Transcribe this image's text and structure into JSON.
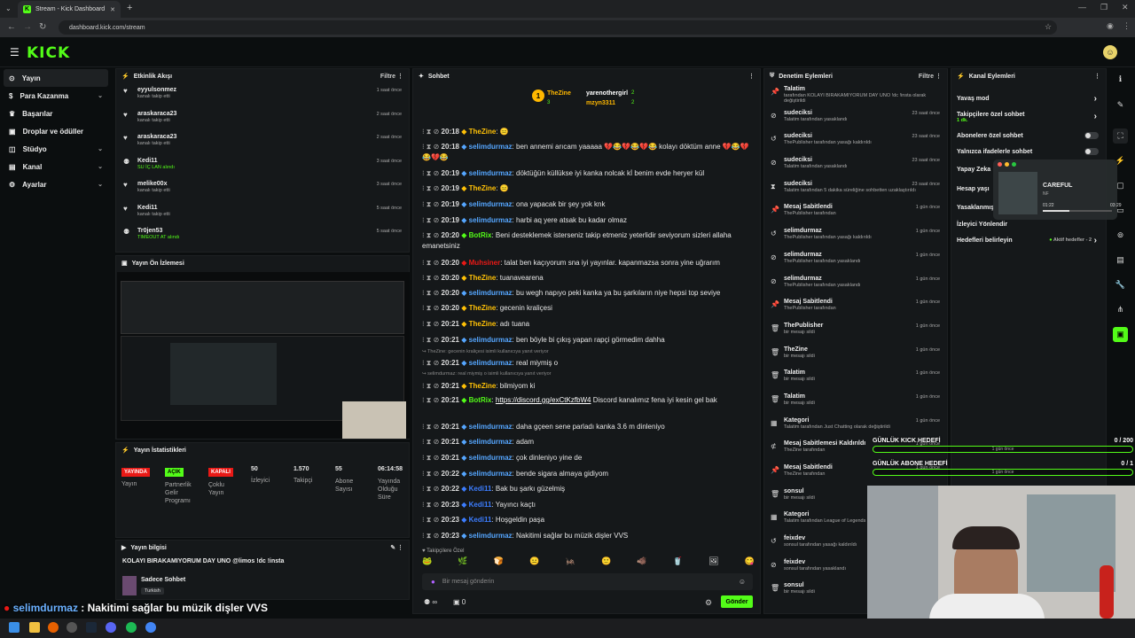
{
  "browser": {
    "tab_title": "Stream - Kick Dashboard",
    "url": "dashboard.kick.com/stream"
  },
  "app": {
    "logo": "KICK"
  },
  "sidebar": {
    "items": [
      {
        "label": "Yayın",
        "icon": "broadcast-icon",
        "active": true
      },
      {
        "label": "Para Kazanma",
        "icon": "dollar-icon",
        "chevron": true
      },
      {
        "label": "Başarılar",
        "icon": "trophy-icon"
      },
      {
        "label": "Droplar ve ödüller",
        "icon": "gift-icon"
      },
      {
        "label": "Stüdyo",
        "icon": "studio-icon",
        "chevron": true
      },
      {
        "label": "Kanal",
        "icon": "channel-icon",
        "chevron": true
      },
      {
        "label": "Ayarlar",
        "icon": "gear-icon",
        "chevron": true
      }
    ]
  },
  "activity": {
    "title": "Etkinlik Akışı",
    "filter": "Filtre",
    "items": [
      {
        "name": "eyyulsonmez",
        "sub": "kanalı takip etti",
        "time": "1 saat önce",
        "icon": "heart"
      },
      {
        "name": "araskaraca23",
        "sub": "kanalı takip etti",
        "time": "2 saat önce",
        "icon": "heart"
      },
      {
        "name": "araskaraca23",
        "sub": "kanalı takip etti",
        "time": "2 saat önce",
        "icon": "heart"
      },
      {
        "name": "Kedi11",
        "sub": "SU İÇ LAN alındı",
        "time": "3 saat önce",
        "icon": "reward"
      },
      {
        "name": "melike00x",
        "sub": "kanalı takip etti",
        "time": "3 saat önce",
        "icon": "heart"
      },
      {
        "name": "Kedi11",
        "sub": "kanalı takip etti",
        "time": "5 saat önce",
        "icon": "heart"
      },
      {
        "name": "Tr0jen53",
        "sub": "TIMEOUT AT alındı",
        "time": "5 saat önce",
        "icon": "reward"
      }
    ]
  },
  "preview": {
    "title": "Yayın Ön İzlemesi"
  },
  "stats": {
    "title": "Yayın İstatistikleri",
    "items": [
      {
        "value": "YAYINDA",
        "label": "Yayın",
        "style": "red"
      },
      {
        "value": "AÇIK",
        "label": "Partnerlik Gelir Programı",
        "style": "green"
      },
      {
        "value": "KAPALI",
        "label": "Çoklu Yayın",
        "style": "red"
      },
      {
        "value": "50",
        "label": "İzleyici"
      },
      {
        "value": "1.570",
        "label": "Takipçi"
      },
      {
        "value": "55",
        "label": "Abone Sayısı"
      },
      {
        "value": "06:14:58",
        "label": "Yayında Olduğu Süre"
      }
    ]
  },
  "streaminfo": {
    "title": "Yayın bilgisi",
    "stream_title": "KOLAYI BIRAKAMIYORUM DAY UNO @limos !dc !insta",
    "category": "Sadece Sohbet",
    "language": "Turkish"
  },
  "chat": {
    "title": "Sohbet",
    "gifters": [
      {
        "name": "TheZine",
        "count": "3",
        "color": "#ffb800"
      },
      {
        "name": "yarenothergirl",
        "count": "2",
        "color": "#ffffff"
      },
      {
        "name": "mzyn3311",
        "count": "2",
        "color": "#ffb800"
      }
    ],
    "messages": [
      {
        "time": "20:18",
        "user": "TheZine",
        "color": "#ffc107",
        "text": "😐"
      },
      {
        "time": "20:18",
        "user": "selimdurmaz",
        "color": "#55a6ff",
        "text": "ben annemi arıcam yaaaaa 💔😂💔😂💔😂 kolayı döktüm anne 💔😂💔😂💔😂"
      },
      {
        "time": "20:19",
        "user": "selimdurmaz",
        "color": "#55a6ff",
        "text": "döktüğün küllükse iyi kanka nolcak kİ benim evde heryer kül"
      },
      {
        "time": "20:19",
        "user": "TheZine",
        "color": "#ffc107",
        "text": "😐"
      },
      {
        "time": "20:19",
        "user": "selimdurmaz",
        "color": "#55a6ff",
        "text": "ona yapacak bir şey yok knk"
      },
      {
        "time": "20:19",
        "user": "selimdurmaz",
        "color": "#55a6ff",
        "text": "harbi aq yere atsak bu kadar olmaz"
      },
      {
        "time": "20:20",
        "user": "BotRix",
        "color": "#53fc18",
        "text": "Beni desteklemek isterseniz takip etmeniz yeterlidir seviyorum sizleri allaha emanetsiniz"
      },
      {
        "time": "20:20",
        "user": "Muhsiner",
        "color": "#e91916",
        "text": "talat ben kaçıyorum sna iyi yayınlar. kapanmazsa sonra yine uğrarım"
      },
      {
        "time": "20:20",
        "user": "TheZine",
        "color": "#ffc107",
        "text": "tuanavearena"
      },
      {
        "time": "20:20",
        "user": "selimdurmaz",
        "color": "#55a6ff",
        "text": "bu wegh napıyo peki kanka ya bu şarkıların niye hepsi top seviye"
      },
      {
        "time": "20:20",
        "user": "TheZine",
        "color": "#ffc107",
        "text": "gecenin kraliçesi"
      },
      {
        "time": "20:21",
        "user": "TheZine",
        "color": "#ffc107",
        "text": "adı tuana"
      },
      {
        "time": "20:21",
        "user": "selimdurmaz",
        "color": "#55a6ff",
        "text": "ben böyle bi çıkış yapan rapçi görmedim dahha"
      },
      {
        "reply": "TheZine: gecenin kraliçesi isimli kullanıcıya yanıt veriyor"
      },
      {
        "time": "20:21",
        "user": "selimdurmaz",
        "color": "#55a6ff",
        "text": "real miymiş o"
      },
      {
        "reply": "selimdurmaz: real miymiş o isimli kullanıcıya yanıt veriyor"
      },
      {
        "time": "20:21",
        "user": "TheZine",
        "color": "#ffc107",
        "text": "bilmiyom ki"
      },
      {
        "time": "20:21",
        "user": "BotRix",
        "color": "#53fc18",
        "link": "https://discord.gg/exCtKzfbW4",
        "text": "Discord kanalımız fena iyi kesin gel bak"
      },
      {
        "time": "20:21",
        "user": "selimdurmaz",
        "color": "#55a6ff",
        "text": "daha gçeen sene parladı kanka 3.6 m dinleniyo"
      },
      {
        "time": "20:21",
        "user": "selimdurmaz",
        "color": "#55a6ff",
        "text": "adam"
      },
      {
        "time": "20:21",
        "user": "selimdurmaz",
        "color": "#55a6ff",
        "text": "çok dinleniyo yine de"
      },
      {
        "time": "20:22",
        "user": "selimdurmaz",
        "color": "#55a6ff",
        "text": "bende sigara almaya gidiyom"
      },
      {
        "time": "20:22",
        "user": "Kedi11",
        "color": "#3c7dff",
        "text": "Bak bu şarkı güzelmiş"
      },
      {
        "time": "20:23",
        "user": "Kedi11",
        "color": "#3c7dff",
        "text": "Yayıncı kaçtı"
      },
      {
        "time": "20:23",
        "user": "Kedi11",
        "color": "#3c7dff",
        "text": "Hoşgeldin paşa"
      },
      {
        "time": "20:23",
        "user": "selimdurmaz",
        "color": "#55a6ff",
        "text": "Nakitimi sağlar bu müzik dişler VVS"
      }
    ],
    "followers_label": "Takipçilere Özel",
    "input_placeholder": "Bir mesaj gönderin",
    "points": "0",
    "send": "Gönder"
  },
  "modlog": {
    "title": "Denetim Eylemleri",
    "filter": "Filtre",
    "items": [
      {
        "name": "Talatim",
        "sub": "tarafından KOLAYI BIRAKAMIYORUM DAY UNO !dc !insta olarak değiştirildi",
        "time": "",
        "icon": "pin"
      },
      {
        "name": "sudeciksi",
        "sub": "Talatim tarafından yasaklandı",
        "time": "23 saat önce",
        "icon": "ban"
      },
      {
        "name": "sudeciksi",
        "sub": "ThePublisher tarafından yasağı kaldırıldı",
        "time": "23 saat önce",
        "icon": "undo"
      },
      {
        "name": "sudeciksi",
        "sub": "Talatim tarafından yasaklandı",
        "time": "23 saat önce",
        "icon": "ban"
      },
      {
        "name": "sudeciksi",
        "sub": "Talatim tarafından 5 dakika süreliğine sohbetten uzaklaştırıldı",
        "time": "23 saat önce",
        "icon": "timer"
      },
      {
        "name": "Mesaj Sabitlendi",
        "sub": "ThePublisher tarafından",
        "time": "1 gün önce",
        "icon": "pin"
      },
      {
        "name": "selimdurmaz",
        "sub": "ThePublisher tarafından yasağı kaldırıldı",
        "time": "1 gün önce",
        "icon": "undo"
      },
      {
        "name": "selimdurmaz",
        "sub": "ThePublisher tarafından yasaklandı",
        "time": "1 gün önce",
        "icon": "ban"
      },
      {
        "name": "selimdurmaz",
        "sub": "ThePublisher tarafından yasaklandı",
        "time": "1 gün önce",
        "icon": "ban"
      },
      {
        "name": "Mesaj Sabitlendi",
        "sub": "ThePublisher tarafından",
        "time": "1 gün önce",
        "icon": "pin"
      },
      {
        "name": "ThePublisher",
        "sub": "bir mesajı sildi",
        "time": "1 gün önce",
        "icon": "trash"
      },
      {
        "name": "TheZine",
        "sub": "bir mesajı sildi",
        "time": "1 gün önce",
        "icon": "trash"
      },
      {
        "name": "Talatim",
        "sub": "bir mesajı sildi",
        "time": "1 gün önce",
        "icon": "trash"
      },
      {
        "name": "Talatim",
        "sub": "bir mesajı sildi",
        "time": "1 gün önce",
        "icon": "trash"
      },
      {
        "name": "Kategori",
        "sub": "Talatim tarafından Just Chatting olarak değiştirildi",
        "time": "1 gün önce",
        "icon": "category"
      },
      {
        "name": "Mesaj Sabitlemesi Kaldırıldı",
        "sub": "TheZine tarafından",
        "time": "1 gün önce",
        "icon": "unpin"
      },
      {
        "name": "Mesaj Sabitlendi",
        "sub": "TheZine tarafından",
        "time": "1 gün önce",
        "icon": "pin"
      },
      {
        "name": "sonsul",
        "sub": "bir mesajı sildi",
        "time": "1 gün önce",
        "icon": "trash"
      },
      {
        "name": "Kategori",
        "sub": "Talatim tarafından League of Legends",
        "time": "",
        "icon": "category"
      },
      {
        "name": "feixdev",
        "sub": "sonsul tarafından yasağı kaldırıldı",
        "time": "",
        "icon": "undo"
      },
      {
        "name": "feixdev",
        "sub": "sonsul tarafından yasaklandı",
        "time": "",
        "icon": "ban"
      },
      {
        "name": "sonsul",
        "sub": "bir mesajı sildi",
        "time": "",
        "icon": "trash"
      }
    ]
  },
  "channel": {
    "title": "Kanal Eylemleri",
    "items": [
      {
        "label": "Yavaş mod",
        "control": "arrow"
      },
      {
        "label": "Takipçilere özel sohbet",
        "sub": "1 dk.",
        "control": "arrow"
      },
      {
        "label": "Abonelere özel sohbet",
        "control": "toggle"
      },
      {
        "label": "Yalnızca ifadelerle sohbet",
        "control": "toggle"
      },
      {
        "label": "Yapay Zeka",
        "control": ""
      },
      {
        "label": "Hesap yaşı",
        "control": ""
      },
      {
        "label": "Yasaklanmış",
        "control": ""
      },
      {
        "label": "İzleyici Yönlendir",
        "control": ""
      },
      {
        "label": "Hedefleri belirleyin",
        "sub": "Aktif hedefler - 2",
        "control": "arrow"
      }
    ]
  },
  "media_player": {
    "track": "CAREFUL",
    "artist": "NF",
    "elapsed": "01:22",
    "total": "03:29",
    "progress": 0.39
  },
  "goals": [
    {
      "label": "GÜNLÜK KICK HEDEFİ",
      "value": "0 / 200",
      "sub": "1 gün önce"
    },
    {
      "label": "GÜNLÜK ABONE HEDEFİ",
      "value": "0 / 1",
      "sub": "1 gün önce"
    }
  ],
  "overlay": {
    "user": "selimdurmaz",
    "text": "Nakitimi sağlar bu müzik dişler VVS"
  }
}
